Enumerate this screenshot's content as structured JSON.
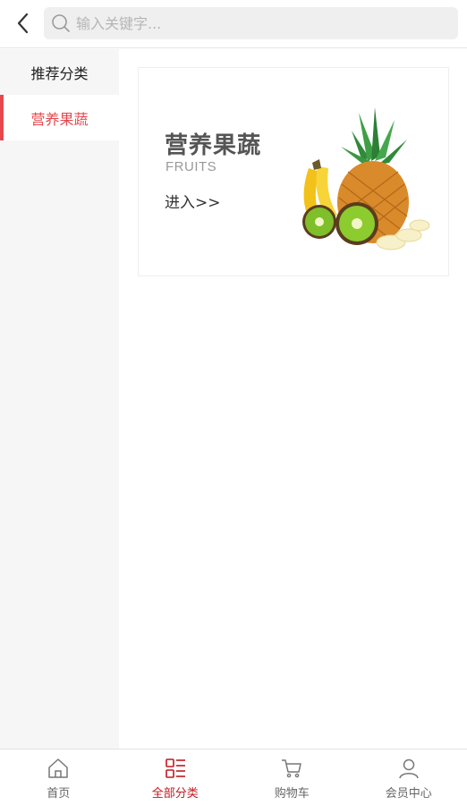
{
  "header": {
    "back_icon": "chevron-left-icon",
    "search_icon": "search-icon",
    "search_placeholder": "输入关键字..."
  },
  "sidebar": {
    "items": [
      {
        "label": "推荐分类",
        "active": false
      },
      {
        "label": "营养果蔬",
        "active": true
      }
    ]
  },
  "banner": {
    "title": "营养果蔬",
    "subtitle": "FRUITS",
    "enter_label": "进入>>",
    "image": "fruit-illustration"
  },
  "tabbar": {
    "active_color": "#c0181e",
    "items": [
      {
        "label": "首页",
        "icon": "home-icon",
        "active": false
      },
      {
        "label": "全部分类",
        "icon": "category-icon",
        "active": true
      },
      {
        "label": "购物车",
        "icon": "cart-icon",
        "active": false
      },
      {
        "label": "会员中心",
        "icon": "user-icon",
        "active": false
      }
    ]
  },
  "colors": {
    "accent": "#e5484d",
    "sidebar_bg": "#f6f6f6",
    "search_bg": "#efefef"
  }
}
